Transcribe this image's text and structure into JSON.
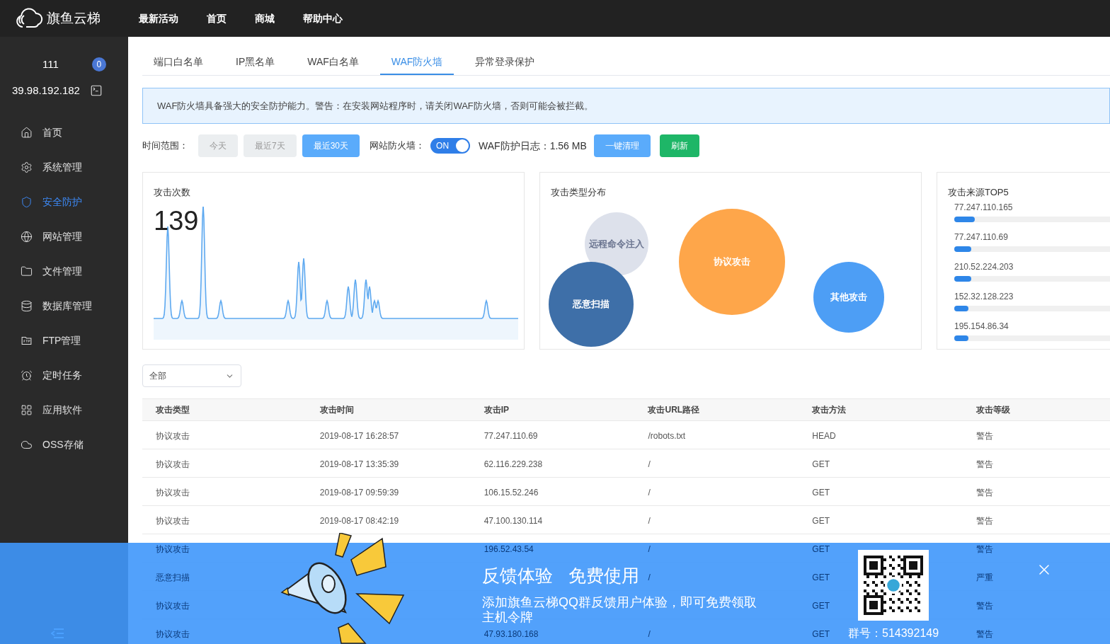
{
  "header": {
    "logo": "旗鱼云梯",
    "nav": [
      "最新活动",
      "首页",
      "商城",
      "帮助中心"
    ]
  },
  "sidebar": {
    "user": "111",
    "badge": "0",
    "ip": "39.98.192.182",
    "items": [
      {
        "kind": "home",
        "label": "首页",
        "selected": false
      },
      {
        "kind": "gear",
        "label": "系统管理",
        "selected": false
      },
      {
        "kind": "shield",
        "label": "安全防护",
        "selected": true
      },
      {
        "kind": "globe",
        "label": "网站管理",
        "selected": false
      },
      {
        "kind": "folder",
        "label": "文件管理",
        "selected": false
      },
      {
        "kind": "database",
        "label": "数据库管理",
        "selected": false
      },
      {
        "kind": "ftp",
        "label": "FTP管理",
        "selected": false
      },
      {
        "kind": "alarm",
        "label": "定时任务",
        "selected": false
      },
      {
        "kind": "grid",
        "label": "应用软件",
        "selected": false
      },
      {
        "kind": "cloud",
        "label": "OSS存储",
        "selected": false
      }
    ]
  },
  "tabs": [
    {
      "label": "端口白名单",
      "selected": false
    },
    {
      "label": "IP黑名单",
      "selected": false
    },
    {
      "label": "WAF白名单",
      "selected": false
    },
    {
      "label": "WAF防火墙",
      "selected": true
    },
    {
      "label": "异常登录保护",
      "selected": false
    }
  ],
  "notice": "WAF防火墙具备强大的安全防护能力。警告：在安装网站程序时，请关闭WAF防火墙，否则可能会被拦截。",
  "toolbar": {
    "range_label": "时间范围：",
    "ranges": [
      {
        "label": "今天",
        "selected": false
      },
      {
        "label": "最近7天",
        "selected": false
      },
      {
        "label": "最近30天",
        "selected": true
      }
    ],
    "firewall_label": "网站防火墙：",
    "firewall": {
      "on": true,
      "label": "ON"
    },
    "log": "WAF防护日志：1.56 MB",
    "buttons": [
      {
        "kind": "primary",
        "label": "一键清理"
      },
      {
        "kind": "success",
        "label": "刷新"
      }
    ]
  },
  "attack_count": {
    "title": "攻击次数",
    "value": "139"
  },
  "attack_types": {
    "title": "攻击类型分布",
    "bubbles": [
      {
        "label": "远程命令注入",
        "color": "#dde1eb"
      },
      {
        "label": "恶意扫描",
        "color": "#3e6fa8"
      },
      {
        "label": "协议攻击",
        "color": "#fea64a"
      },
      {
        "label": "其他攻击",
        "color": "#4d9ef5"
      }
    ]
  },
  "top_sources": {
    "title": "攻击来源TOP5",
    "items": [
      {
        "ip": "77.247.110.165",
        "level": 0.12
      },
      {
        "ip": "77.247.110.69",
        "level": 0.1
      },
      {
        "ip": "210.52.224.203",
        "level": 0.1
      },
      {
        "ip": "152.32.128.223",
        "level": 0.085
      },
      {
        "ip": "195.154.86.34",
        "level": 0.085
      }
    ]
  },
  "filter": {
    "value": "全部"
  },
  "table": {
    "columns": [
      "攻击类型",
      "攻击时间",
      "攻击IP",
      "攻击URL路径",
      "攻击方法",
      "攻击等级"
    ],
    "rows": [
      [
        "协议攻击",
        "2019-08-17 16:28:57",
        "77.247.110.69",
        "/robots.txt",
        "HEAD",
        "警告"
      ],
      [
        "协议攻击",
        "2019-08-17 13:35:39",
        "62.116.229.238",
        "/",
        "GET",
        "警告"
      ],
      [
        "协议攻击",
        "2019-08-17 09:59:39",
        "106.15.52.246",
        "/",
        "GET",
        "警告"
      ],
      [
        "协议攻击",
        "2019-08-17 08:42:19",
        "47.100.130.114",
        "/",
        "GET",
        "警告"
      ],
      [
        "协议攻击",
        null,
        "196.52.43.54",
        "/",
        "GET",
        "警告"
      ],
      [
        "恶意扫描",
        null,
        null,
        "/",
        "GET",
        "严重"
      ],
      [
        "协议攻击",
        null,
        null,
        null,
        "GET",
        "警告"
      ],
      [
        "协议攻击",
        null,
        "47.93.180.168",
        "/",
        "GET",
        "警告"
      ]
    ]
  },
  "promo": {
    "title_1": "反馈体验",
    "title_2": "免费使用",
    "text": "添加旗鱼云梯QQ群反馈用户体验，即可免费领取主机令牌",
    "group": "群号：514392149"
  }
}
